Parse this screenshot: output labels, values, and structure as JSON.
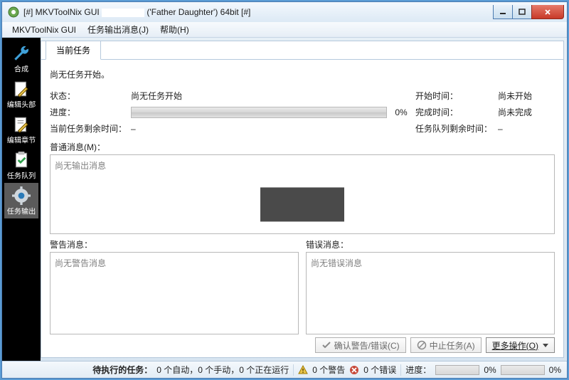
{
  "window": {
    "title_prefix": "[#] MKVToolNix GUI",
    "title_middle": "('Father Daughter') 64bit [#]"
  },
  "menu": [
    "MKVToolNix GUI",
    "任务输出消息(J)",
    "帮助(H)"
  ],
  "sidebar": [
    {
      "key": "merge",
      "label": "合成"
    },
    {
      "key": "headers",
      "label": "编辑头部"
    },
    {
      "key": "chapters",
      "label": "编辑章节"
    },
    {
      "key": "queue",
      "label": "任务队列"
    },
    {
      "key": "output",
      "label": "任务输出"
    }
  ],
  "tabs": {
    "current": "当前任务"
  },
  "info": {
    "no_task": "尚无任务开始。",
    "status_label": "状态：",
    "status_value": "尚无任务开始",
    "progress_label": "进度：",
    "progress_pct": "0%",
    "start_label": "开始时间：",
    "start_value": "尚未开始",
    "finish_label": "完成时间：",
    "finish_value": "尚未完成",
    "remain_label": "当前任务剩余时间：",
    "remain_value": "–",
    "queue_remain_label": "任务队列剩余时间：",
    "queue_remain_value": "–"
  },
  "messages": {
    "normal_label": "普通消息(M)：",
    "normal_placeholder": "尚无输出消息",
    "warn_label": "警告消息：",
    "warn_placeholder": "尚无警告消息",
    "error_label": "错误消息：",
    "error_placeholder": "尚无错误消息"
  },
  "buttons": {
    "ack": "确认警告/错误(C)",
    "abort": "中止任务(A)",
    "more": "更多操作(O)"
  },
  "status": {
    "pending_label": "待执行的任务：",
    "pending_value": "0 个自动，0 个手动，0 个正在运行",
    "warn_count": "0 个警告",
    "error_count": "0 个错误",
    "progress_label": "进度：",
    "p1": "0%",
    "p2": "0%"
  }
}
